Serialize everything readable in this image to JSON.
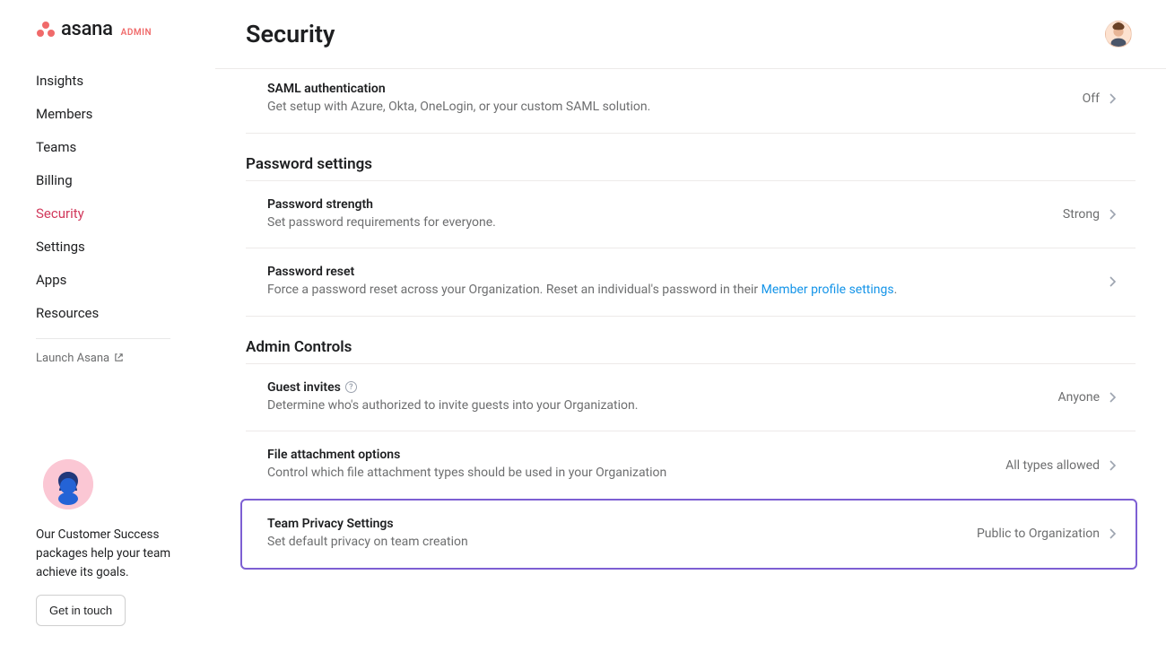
{
  "brand": {
    "name": "asana",
    "suffix": "ADMIN"
  },
  "sidebar": {
    "items": [
      {
        "label": "Insights",
        "active": false
      },
      {
        "label": "Members",
        "active": false
      },
      {
        "label": "Teams",
        "active": false
      },
      {
        "label": "Billing",
        "active": false
      },
      {
        "label": "Security",
        "active": true
      },
      {
        "label": "Settings",
        "active": false
      },
      {
        "label": "Apps",
        "active": false
      },
      {
        "label": "Resources",
        "active": false
      }
    ],
    "launch_label": "Launch Asana"
  },
  "support": {
    "text": "Our Customer Success packages help your team achieve its goals.",
    "button": "Get in touch"
  },
  "header": {
    "title": "Security"
  },
  "sections": {
    "auth": {
      "saml": {
        "title": "SAML authentication",
        "desc": "Get setup with Azure, Okta, OneLogin, or your custom SAML solution.",
        "value": "Off"
      }
    },
    "password": {
      "heading": "Password settings",
      "strength": {
        "title": "Password strength",
        "desc": "Set password requirements for everyone.",
        "value": "Strong"
      },
      "reset": {
        "title": "Password reset",
        "desc_prefix": "Force a password reset across your Organization. Reset an individual's password in their ",
        "link_text": "Member profile settings",
        "desc_suffix": "."
      }
    },
    "admin": {
      "heading": "Admin Controls",
      "guests": {
        "title": "Guest invites",
        "desc": "Determine who's authorized to invite guests into your Organization.",
        "value": "Anyone"
      },
      "files": {
        "title": "File attachment options",
        "desc": "Control which file attachment types should be used in your Organization",
        "value": "All types allowed"
      },
      "privacy": {
        "title": "Team Privacy Settings",
        "desc": "Set default privacy on team creation",
        "value": "Public to Organization"
      }
    }
  }
}
